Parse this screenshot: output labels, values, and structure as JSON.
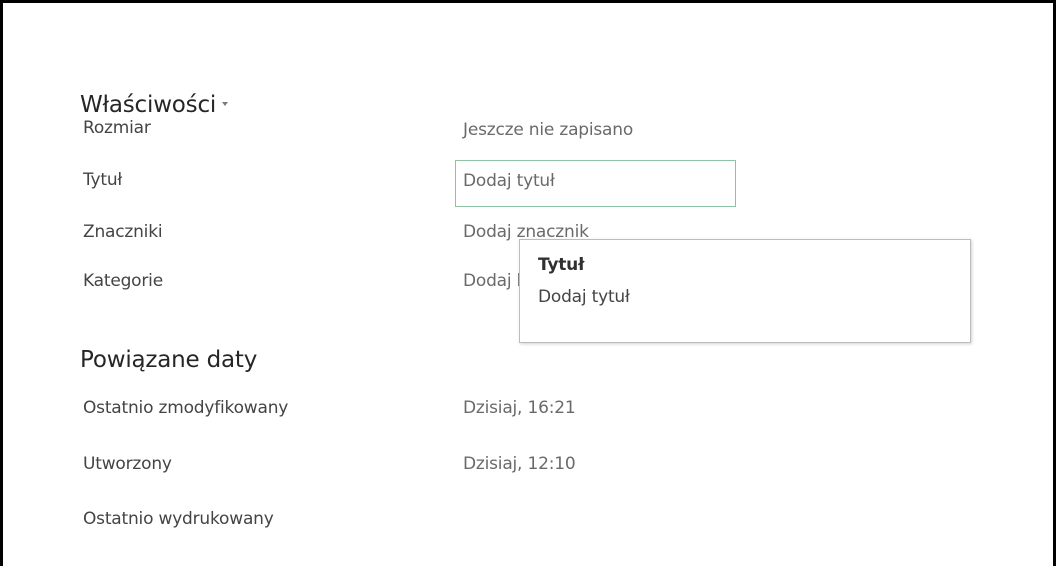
{
  "properties": {
    "title": "Właściwości",
    "rows": [
      {
        "label": "Rozmiar",
        "value": "Jeszcze nie zapisano"
      },
      {
        "label": "Tytuł",
        "value": "Dodaj tytuł"
      },
      {
        "label": "Znaczniki",
        "value": "Dodaj znacznik"
      },
      {
        "label": "Kategorie",
        "value": "Dodaj kategorię"
      }
    ]
  },
  "tooltip": {
    "title": "Tytuł",
    "text": "Dodaj tytuł"
  },
  "dates": {
    "title": "Powiązane daty",
    "rows": [
      {
        "label": "Ostatnio zmodyfikowany",
        "value": "Dzisiaj, 16:21"
      },
      {
        "label": "Utworzony",
        "value": "Dzisiaj, 12:10"
      },
      {
        "label": "Ostatnio wydrukowany",
        "value": ""
      }
    ]
  }
}
